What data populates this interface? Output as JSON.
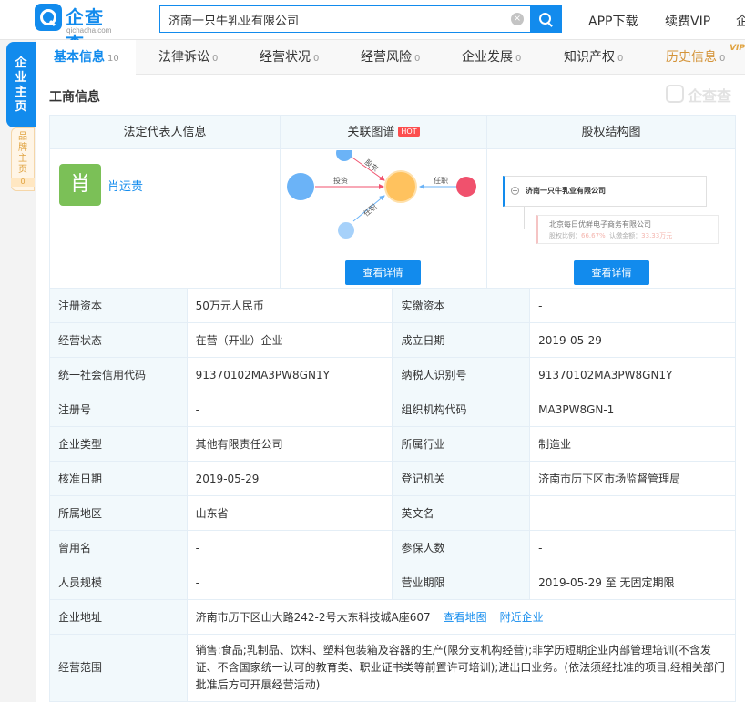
{
  "header": {
    "logo_name": "企查查",
    "logo_domain": "qichacha.com",
    "search_value": "济南一只牛乳业有限公司",
    "clear_glyph": "×",
    "nav": [
      "APP下载",
      "续费VIP",
      "企"
    ]
  },
  "side": {
    "main_label": [
      "企",
      "业",
      "主",
      "页"
    ],
    "brand_label": [
      "品",
      "牌",
      "主",
      "页"
    ],
    "brand_count": "0"
  },
  "tabs": [
    {
      "label": "基本信息",
      "count": "10"
    },
    {
      "label": "法律诉讼",
      "count": "0"
    },
    {
      "label": "经营状况",
      "count": "0"
    },
    {
      "label": "经营风险",
      "count": "0"
    },
    {
      "label": "企业发展",
      "count": "0"
    },
    {
      "label": "知识产权",
      "count": "0"
    },
    {
      "label": "历史信息",
      "count": "0"
    }
  ],
  "vip_badge": "VIP",
  "section_title": "工商信息",
  "watermark": "企查查",
  "cards": {
    "legal_head": "法定代表人信息",
    "graph_head": "关联图谱",
    "hot": "HOT",
    "equity_head": "股权结构图",
    "avatar_char": "肖",
    "legal_name": "肖运贵",
    "graph_labels": {
      "l1": "投资",
      "l2": "股东",
      "l3": "任职",
      "l4": "任职"
    },
    "detail_btn": "查看详情",
    "equity_company": "济南一只牛乳业有限公司",
    "equity_sub_name": "北京每日优鲜电子商务有限公司",
    "equity_sub_ratio_label": "股权比例：",
    "equity_sub_ratio": "66.67%",
    "equity_sub_amount_label": "认缴金额：",
    "equity_sub_amount": "33.33万元"
  },
  "colors": {
    "accent": "#128bed",
    "avatar": "#7bc057",
    "graph_center": "#ffc25e",
    "graph_blue": "#6bb3f7",
    "graph_red": "#f0516d"
  },
  "info": {
    "rows": [
      [
        "注册资本",
        "50万元人民币",
        "实缴资本",
        "-"
      ],
      [
        "经营状态",
        "在营（开业）企业",
        "成立日期",
        "2019-05-29"
      ],
      [
        "统一社会信用代码",
        "91370102MA3PW8GN1Y",
        "纳税人识别号",
        "91370102MA3PW8GN1Y"
      ],
      [
        "注册号",
        "-",
        "组织机构代码",
        "MA3PW8GN-1"
      ],
      [
        "企业类型",
        "其他有限责任公司",
        "所属行业",
        "制造业"
      ],
      [
        "核准日期",
        "2019-05-29",
        "登记机关",
        "济南市历下区市场监督管理局"
      ],
      [
        "所属地区",
        "山东省",
        "英文名",
        "-"
      ],
      [
        "曾用名",
        "-",
        "参保人数",
        "-"
      ],
      [
        "人员规模",
        "-",
        "营业期限",
        "2019-05-29 至 无固定期限"
      ]
    ],
    "address_label": "企业地址",
    "address": "济南市历下区山大路242-2号大东科技城A座607",
    "map_link": "查看地图",
    "nearby_link": "附近企业",
    "scope_label": "经营范围",
    "scope": "销售:食品;乳制品、饮料、塑料包装箱及容器的生产(限分支机构经营);非学历短期企业内部管理培训(不含发证、不含国家统一认可的教育类、职业证书类等前置许可培训);进出口业务。(依法须经批准的项目,经相关部门批准后方可开展经营活动)"
  }
}
